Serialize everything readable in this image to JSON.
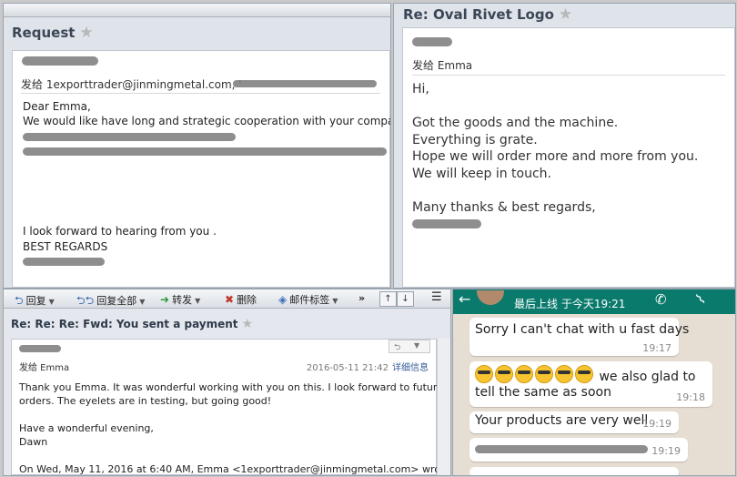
{
  "top_left": {
    "title": "Request",
    "send_to": "发给 1exporttrader@jinmingmetal.com, '",
    "greeting": "Dear Emma,",
    "line1": "We would like have long and strategic cooperation with your company,",
    "line2": "I look forward to  hearing from you .",
    "line3": "BEST REGARDS"
  },
  "top_right": {
    "title": "Re: Oval Rivet Logo",
    "send_to": "发给 Emma",
    "body": "Hi,\n\nGot the goods and the machine.\nEverything is grate.\nHope we will order more and more from you.\nWe will keep in touch.\n\nMany thanks & best regards,"
  },
  "bottom_left": {
    "toolbar": {
      "reply": "回复",
      "reply_all": "回复全部",
      "forward": "转发",
      "delete": "删除",
      "tag": "邮件标签",
      "more": "»"
    },
    "title": "Re: Re: Re: Fwd: You sent a payment",
    "send_to": "发给 Emma",
    "date": "2016-05-11 21:42",
    "details": "详细信息",
    "body": "Thank you Emma. It was wonderful working with you on this. I look forward to future\norders. The eyelets are in testing, but going good!\n\nHave a wonderful evening,\nDawn\n\nOn Wed, May 11, 2016 at 6:40 AM, Emma <1exporttrader@jinmingmetal.com> wrote:"
  },
  "chat": {
    "last_seen": "最后上线 于今天19:21",
    "messages": [
      {
        "text": "Sorry I can't chat with u fast days",
        "time": "19:17"
      },
      {
        "text": "we also glad to",
        "text2": "tell the same as soon",
        "time": "19:18"
      },
      {
        "text": "Your products are very well",
        "time": "19:19"
      },
      {
        "text": "",
        "time": "19:19"
      }
    ]
  }
}
